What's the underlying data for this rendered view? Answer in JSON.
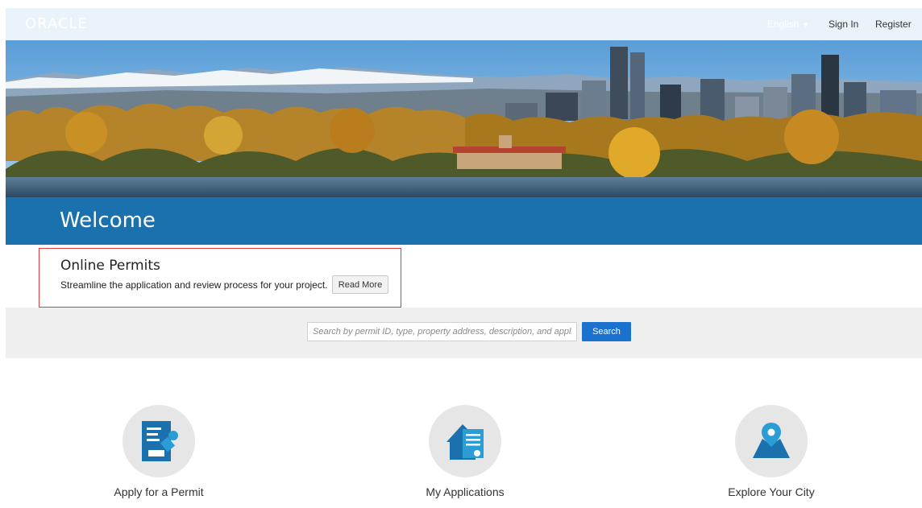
{
  "header": {
    "logo_text": "ORACLE",
    "language": "English",
    "sign_in": "Sign In",
    "register": "Register"
  },
  "welcome": {
    "title": "Welcome"
  },
  "online_permits": {
    "title": "Online Permits",
    "description": "Streamline the application and review process for your project.",
    "read_more": "Read More"
  },
  "search": {
    "placeholder": "Search by permit ID, type, property address, description, and applicant",
    "button": "Search"
  },
  "tiles": [
    {
      "label": "Apply for a Permit",
      "icon": "apply-permit-icon"
    },
    {
      "label": "My Applications",
      "icon": "my-applications-icon"
    },
    {
      "label": "Explore Your City",
      "icon": "explore-city-icon"
    }
  ],
  "colors": {
    "brand_blue": "#1b71ae",
    "search_button": "#1b71ce",
    "highlight_border": "#e23b3b",
    "header_bg": "#eaf3f9"
  }
}
